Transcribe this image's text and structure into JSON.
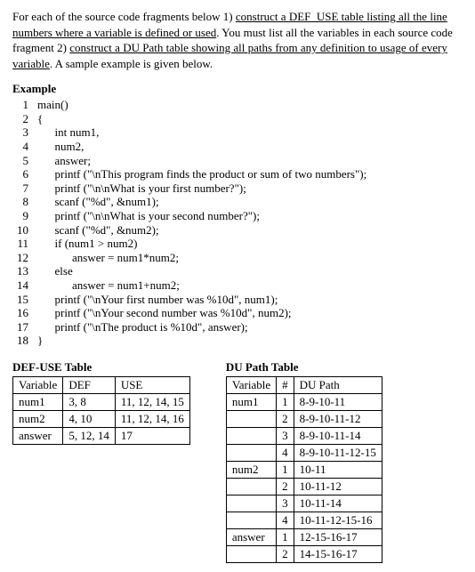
{
  "instructions": {
    "p1a": "For each of the source code fragments below 1) ",
    "p1u1": "construct a DEF_USE table listing all the line numbers where a variable is defined or used",
    "p1b": ". You must list all the variables in each source code fragment 2) ",
    "p1u2": "construct a DU Path table showing all paths from any definition to usage of every variable",
    "p1c": ". A sample example is given below."
  },
  "example_label": "Example",
  "code": [
    {
      "n": "1",
      "t": "main()"
    },
    {
      "n": "2",
      "t": "{"
    },
    {
      "n": "3",
      "t": "      int num1,"
    },
    {
      "n": "4",
      "t": "      num2,"
    },
    {
      "n": "5",
      "t": "      answer;"
    },
    {
      "n": "6",
      "t": "      printf (\"\\nThis program finds the product or sum of two numbers\");"
    },
    {
      "n": "7",
      "t": "      printf (\"\\n\\nWhat is your first number?\");"
    },
    {
      "n": "8",
      "t": "      scanf (\"%d\", &num1);"
    },
    {
      "n": "9",
      "t": "      printf (\"\\n\\nWhat is your second number?\");"
    },
    {
      "n": "10",
      "t": "      scanf (\"%d\", &num2);"
    },
    {
      "n": "11",
      "t": "      if (num1 > num2)"
    },
    {
      "n": "12",
      "t": "            answer = num1*num2;"
    },
    {
      "n": "13",
      "t": "      else"
    },
    {
      "n": "14",
      "t": "            answer = num1+num2;"
    },
    {
      "n": "15",
      "t": "      printf (\"\\nYour first number was %10d\", num1);"
    },
    {
      "n": "16",
      "t": "      printf (\"\\nYour second number was %10d\", num2);"
    },
    {
      "n": "17",
      "t": "      printf (\"\\nThe product is %10d\", answer);"
    },
    {
      "n": "18",
      "t": "}"
    }
  ],
  "defuse": {
    "title": "DEF-USE Table",
    "headers": {
      "c1": "Variable",
      "c2": "DEF",
      "c3": "USE"
    },
    "rows": [
      {
        "v": "num1",
        "d": "3, 8",
        "u": "11, 12, 14, 15"
      },
      {
        "v": "num2",
        "d": "4, 10",
        "u": "11, 12, 14, 16"
      },
      {
        "v": "answer",
        "d": "5, 12, 14",
        "u": "17"
      }
    ]
  },
  "dupath": {
    "title": "DU Path Table",
    "headers": {
      "c1": "Variable",
      "c2": "#",
      "c3": "DU Path"
    },
    "rows": [
      {
        "v": "num1",
        "n": "1",
        "p": "8-9-10-11"
      },
      {
        "v": "",
        "n": "2",
        "p": "8-9-10-11-12"
      },
      {
        "v": "",
        "n": "3",
        "p": "8-9-10-11-14"
      },
      {
        "v": "",
        "n": "4",
        "p": "8-9-10-11-12-15"
      },
      {
        "v": "num2",
        "n": "1",
        "p": "10-11"
      },
      {
        "v": "",
        "n": "2",
        "p": "10-11-12"
      },
      {
        "v": "",
        "n": "3",
        "p": "10-11-14"
      },
      {
        "v": "",
        "n": "4",
        "p": "10-11-12-15-16"
      },
      {
        "v": "answer",
        "n": "1",
        "p": "12-15-16-17"
      },
      {
        "v": "",
        "n": "2",
        "p": "14-15-16-17"
      }
    ]
  }
}
